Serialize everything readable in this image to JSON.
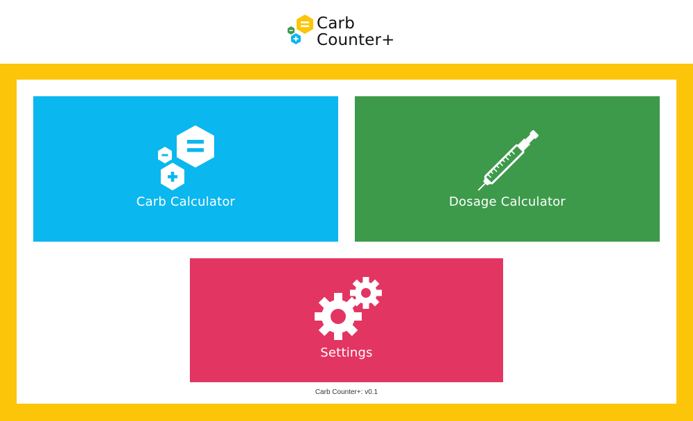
{
  "app": {
    "logo_line1": "Carb",
    "logo_line2": "Counter+"
  },
  "tiles": {
    "carb": {
      "label": "Carb Calculator",
      "color": "#0bb7ef",
      "icon": "hexagon-calculator-icon"
    },
    "dosage": {
      "label": "Dosage Calculator",
      "color": "#3d9a4b",
      "icon": "insulin-pen-icon"
    },
    "settings": {
      "label": "Settings",
      "color": "#e33562",
      "icon": "gears-icon"
    }
  },
  "footer": {
    "version": "Carb Counter+: v0.1"
  },
  "colors": {
    "frame": "#fcc50a",
    "logo_yellow": "#fcc50a",
    "logo_green": "#3d9a4b",
    "logo_blue": "#0bb7ef"
  }
}
